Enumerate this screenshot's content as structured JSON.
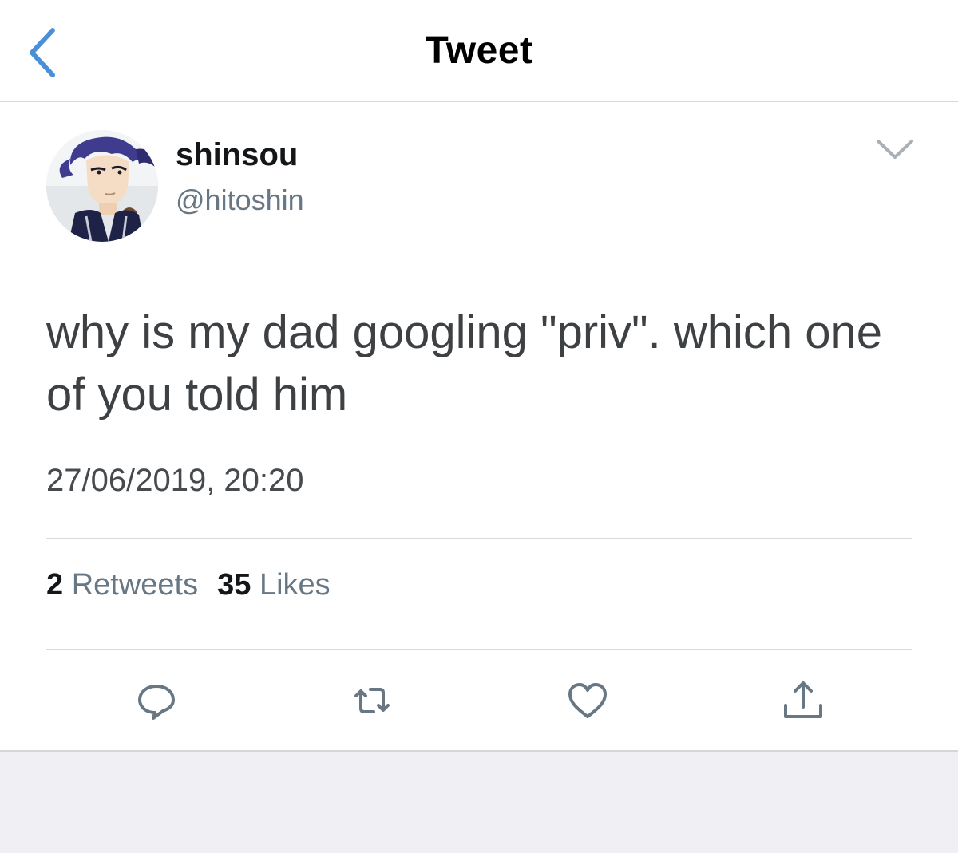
{
  "header": {
    "title": "Tweet",
    "back_icon": "chevron-left-icon"
  },
  "tweet": {
    "display_name": "shinsou",
    "handle": "@hitoshin",
    "text": "why is my dad googling \"priv\". which one of you told him",
    "timestamp": "27/06/2019, 20:20",
    "retweet_count": "2",
    "retweet_label": "Retweets",
    "like_count": "35",
    "like_label": "Likes"
  },
  "actions": [
    {
      "icon": "reply-icon"
    },
    {
      "icon": "retweet-icon"
    },
    {
      "icon": "like-icon"
    },
    {
      "icon": "share-icon"
    }
  ],
  "colors": {
    "accent": "#4a90d9",
    "icon_gray": "#687784",
    "text_dark": "#14171a"
  }
}
